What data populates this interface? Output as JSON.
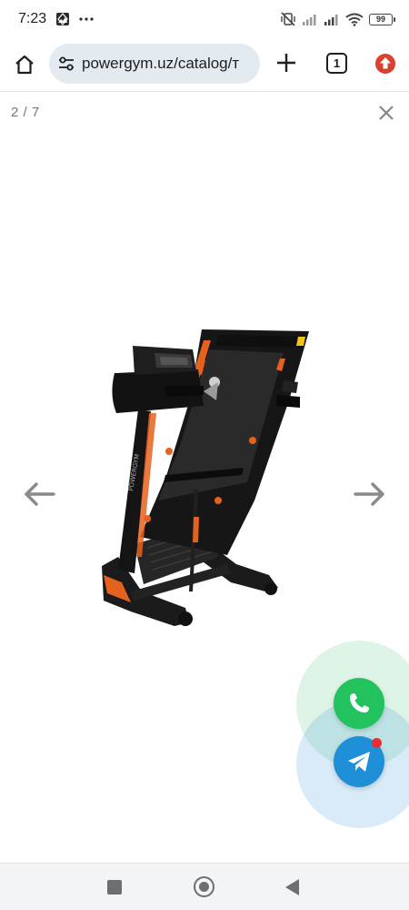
{
  "status_bar": {
    "time": "7:23",
    "battery": "99",
    "icons": [
      "gallery-icon",
      "more-dots-icon",
      "vibrate-off-icon",
      "signal-icon",
      "signal-icon",
      "wifi-icon",
      "battery-icon"
    ]
  },
  "browser": {
    "url": "powergym.uz/catalog/т",
    "tab_count": "1",
    "icons": [
      "home-icon",
      "site-settings-icon",
      "plus-icon",
      "tabs-icon",
      "update-icon"
    ]
  },
  "lightbox": {
    "counter": "2 / 7",
    "image_alt": "treadmill",
    "icons": [
      "close-icon",
      "arrow-left-icon",
      "arrow-right-icon"
    ]
  },
  "floating": {
    "icons": [
      "whatsapp-icon",
      "telegram-icon"
    ],
    "colors": {
      "whatsapp": "#22c35e",
      "telegram": "#1f8fd8",
      "notification": "#f02b2b"
    }
  },
  "navigation": {
    "icons": [
      "recent-apps-icon",
      "home-circle-icon",
      "back-icon"
    ]
  }
}
